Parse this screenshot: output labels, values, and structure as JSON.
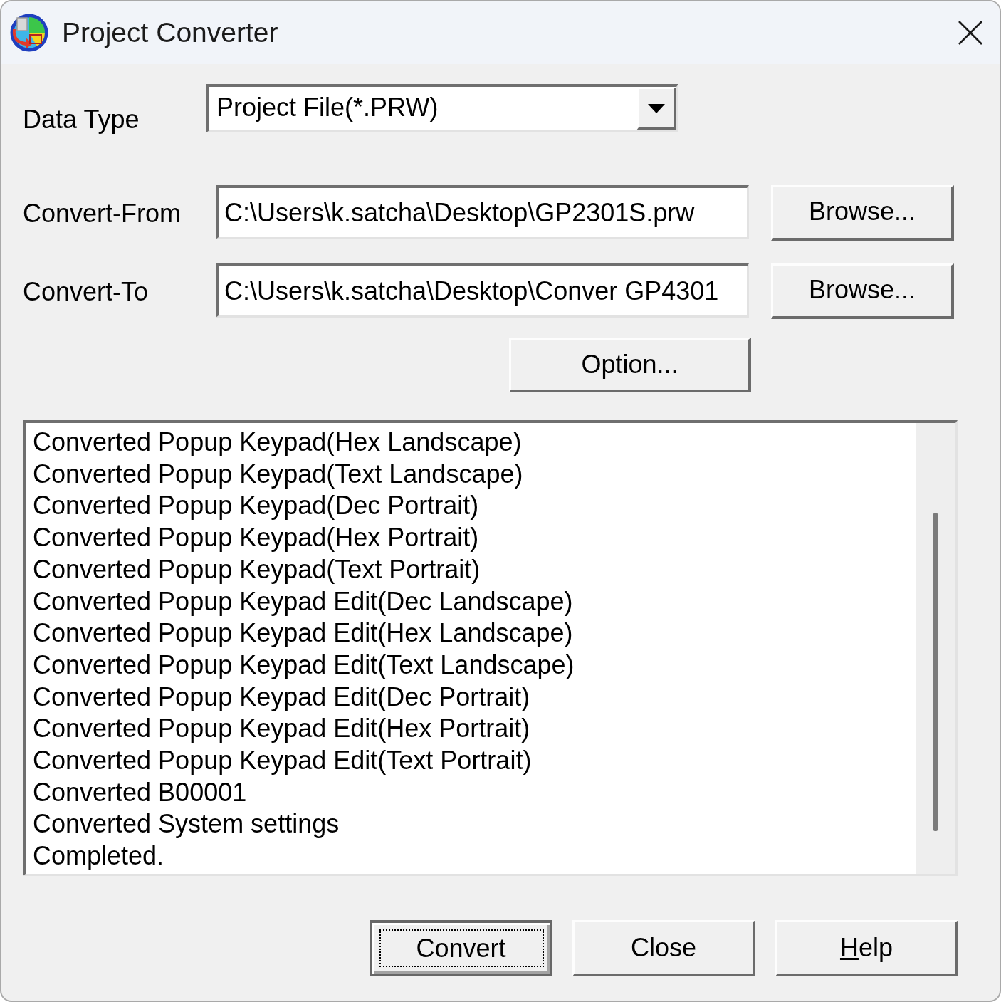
{
  "window": {
    "title": "Project Converter"
  },
  "data_type": {
    "label": "Data Type",
    "value": "Project File(*.PRW)"
  },
  "paths": [
    {
      "label": "Convert-From",
      "value": "C:\\Users\\k.satcha\\Desktop\\GP2301S.prw",
      "button": "Browse..."
    },
    {
      "label": "Convert-To",
      "value": "C:\\Users\\k.satcha\\Desktop\\Conver GP4301",
      "button": "Browse..."
    }
  ],
  "option_button": "Option...",
  "log": [
    "Converted Popup Keypad(Hex Landscape)",
    "Converted Popup Keypad(Text Landscape)",
    "Converted Popup Keypad(Dec Portrait)",
    "Converted Popup Keypad(Hex Portrait)",
    "Converted Popup Keypad(Text Portrait)",
    "Converted Popup Keypad Edit(Dec Landscape)",
    "Converted Popup Keypad Edit(Hex Landscape)",
    "Converted Popup Keypad Edit(Text Landscape)",
    "Converted Popup Keypad Edit(Dec Portrait)",
    "Converted Popup Keypad Edit(Hex Portrait)",
    "Converted Popup Keypad Edit(Text Portrait)",
    "Converted B00001",
    "Converted System settings",
    "Completed."
  ],
  "buttons": [
    {
      "label": "Convert",
      "default": true,
      "focused": true,
      "access_key_underlined": false
    },
    {
      "label": "Close",
      "default": false,
      "focused": false,
      "access_key_underlined": false
    },
    {
      "label": "Help",
      "default": false,
      "focused": false,
      "access_key_underlined": true
    }
  ]
}
